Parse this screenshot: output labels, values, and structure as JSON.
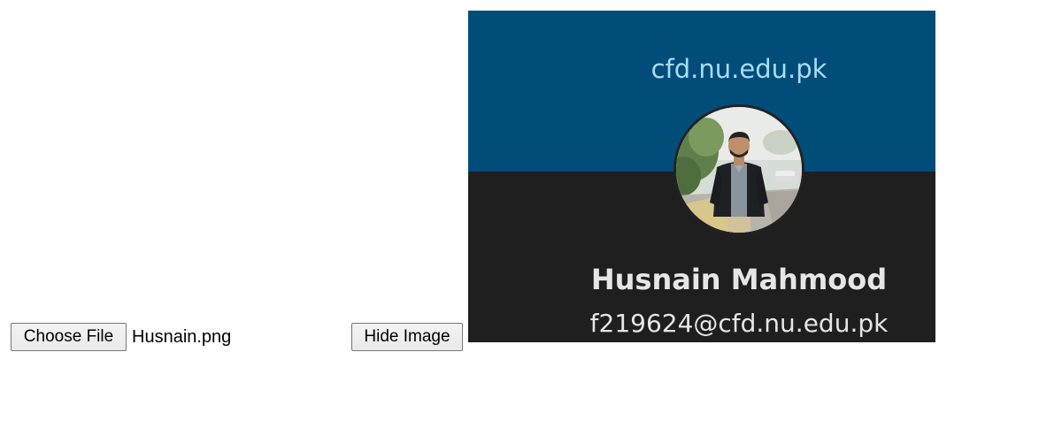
{
  "file_input": {
    "button_label": "Choose File",
    "file_name": "Husnain.png"
  },
  "hide_button": {
    "label": "Hide Image"
  },
  "image_preview": {
    "domain": "cfd.nu.edu.pk",
    "name": "Husnain Mahmood",
    "email": "f219624@cfd.nu.edu.pk",
    "colors": {
      "header": "#004d7a",
      "body": "#1f1f1f",
      "domain_text": "#a9dcf5",
      "text": "#e6e6e6"
    }
  }
}
